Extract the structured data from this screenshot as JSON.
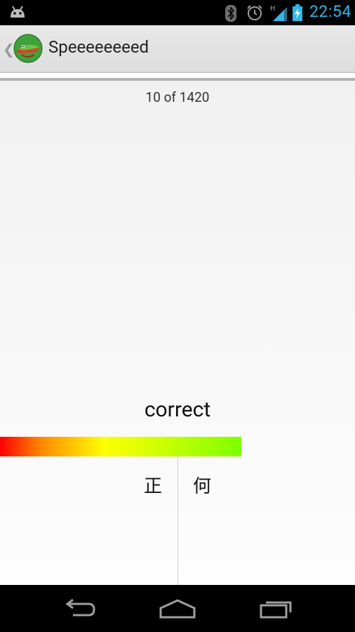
{
  "status_bar": {
    "time": "22:54",
    "icons": [
      "android-debug-icon",
      "bluetooth-icon",
      "alarm-icon",
      "signal-h-icon",
      "battery-charging-icon"
    ],
    "signal_label": "H",
    "accent_color": "#33b5e5"
  },
  "action_bar": {
    "title": "Speeeeeeeed",
    "logo": "crocodile-app-icon"
  },
  "quiz": {
    "counter": "10 of 1420",
    "word": "correct",
    "progress_fraction": 0.68,
    "choices": [
      {
        "label": "正"
      },
      {
        "label": "何"
      }
    ]
  },
  "nav_bar": {
    "buttons": [
      "back-icon",
      "home-icon",
      "recent-apps-icon"
    ]
  }
}
